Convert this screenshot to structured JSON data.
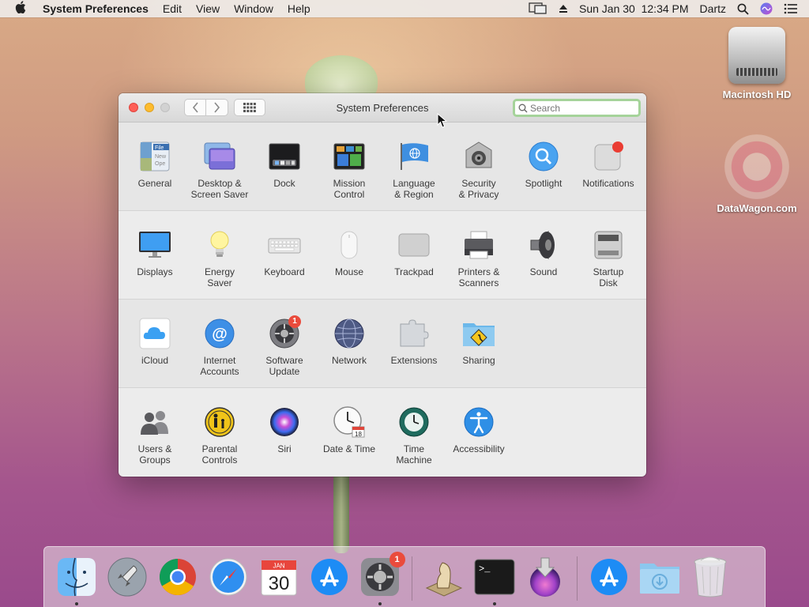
{
  "menubar": {
    "app_name": "System Preferences",
    "menus": [
      "Edit",
      "View",
      "Window",
      "Help"
    ],
    "datetime": "Sun Jan 30  12:34 PM",
    "user": "Dartz"
  },
  "desktop": {
    "icons": [
      {
        "label": "Macintosh HD",
        "icon": "hard-drive-icon"
      },
      {
        "label": "DataWagon.com",
        "icon": "datawagon-logo-icon"
      }
    ]
  },
  "window": {
    "title": "System Preferences",
    "search_placeholder": "Search"
  },
  "sections": [
    [
      {
        "label": "General",
        "icon": "general-icon"
      },
      {
        "label": "Desktop &\nScreen Saver",
        "icon": "desktop-screensaver-icon"
      },
      {
        "label": "Dock",
        "icon": "dock-icon"
      },
      {
        "label": "Mission\nControl",
        "icon": "mission-control-icon"
      },
      {
        "label": "Language\n& Region",
        "icon": "language-region-icon"
      },
      {
        "label": "Security\n& Privacy",
        "icon": "security-privacy-icon"
      },
      {
        "label": "Spotlight",
        "icon": "spotlight-icon"
      },
      {
        "label": "Notifications",
        "icon": "notifications-icon"
      }
    ],
    [
      {
        "label": "Displays",
        "icon": "displays-icon"
      },
      {
        "label": "Energy\nSaver",
        "icon": "energy-saver-icon"
      },
      {
        "label": "Keyboard",
        "icon": "keyboard-icon"
      },
      {
        "label": "Mouse",
        "icon": "mouse-icon"
      },
      {
        "label": "Trackpad",
        "icon": "trackpad-icon"
      },
      {
        "label": "Printers &\nScanners",
        "icon": "printers-scanners-icon"
      },
      {
        "label": "Sound",
        "icon": "sound-icon"
      },
      {
        "label": "Startup\nDisk",
        "icon": "startup-disk-icon"
      }
    ],
    [
      {
        "label": "iCloud",
        "icon": "icloud-icon"
      },
      {
        "label": "Internet\nAccounts",
        "icon": "internet-accounts-icon"
      },
      {
        "label": "Software\nUpdate",
        "icon": "software-update-icon",
        "badge": "1"
      },
      {
        "label": "Network",
        "icon": "network-icon"
      },
      {
        "label": "Extensions",
        "icon": "extensions-icon"
      },
      {
        "label": "Sharing",
        "icon": "sharing-icon"
      }
    ],
    [
      {
        "label": "Users &\nGroups",
        "icon": "users-groups-icon"
      },
      {
        "label": "Parental\nControls",
        "icon": "parental-controls-icon"
      },
      {
        "label": "Siri",
        "icon": "siri-icon"
      },
      {
        "label": "Date & Time",
        "icon": "date-time-icon"
      },
      {
        "label": "Time\nMachine",
        "icon": "time-machine-icon"
      },
      {
        "label": "Accessibility",
        "icon": "accessibility-icon"
      }
    ]
  ],
  "dock": {
    "items": [
      {
        "name": "finder",
        "running": true
      },
      {
        "name": "launchpad",
        "running": false
      },
      {
        "name": "chrome",
        "running": false
      },
      {
        "name": "safari",
        "running": false
      },
      {
        "name": "calendar",
        "running": false,
        "month": "JAN",
        "day": "30"
      },
      {
        "name": "app-store",
        "running": false
      },
      {
        "name": "system-preferences",
        "running": true,
        "badge": "1"
      },
      {
        "name": "separator"
      },
      {
        "name": "chess",
        "running": false
      },
      {
        "name": "terminal",
        "running": true
      },
      {
        "name": "installer",
        "running": false
      },
      {
        "name": "separator"
      },
      {
        "name": "app-store-downloads",
        "running": false
      },
      {
        "name": "downloads-folder",
        "running": false
      },
      {
        "name": "trash",
        "running": false
      }
    ]
  },
  "colors": {
    "accent": "#3478f6",
    "badge": "#ea4b3c",
    "close": "#fe5f57",
    "minimize": "#febc2e"
  }
}
